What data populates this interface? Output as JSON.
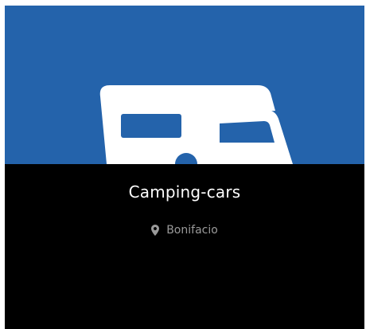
{
  "card": {
    "title": "Camping-cars",
    "location": "Bonifacio",
    "icons": {
      "image": "camper-van-icon",
      "location": "map-marker-icon"
    }
  },
  "colors": {
    "image_background": "#2463ab",
    "icon_fill": "#ffffff",
    "caption_background": "#000000",
    "title_text": "#ffffff",
    "location_text": "#9a9a9a"
  }
}
